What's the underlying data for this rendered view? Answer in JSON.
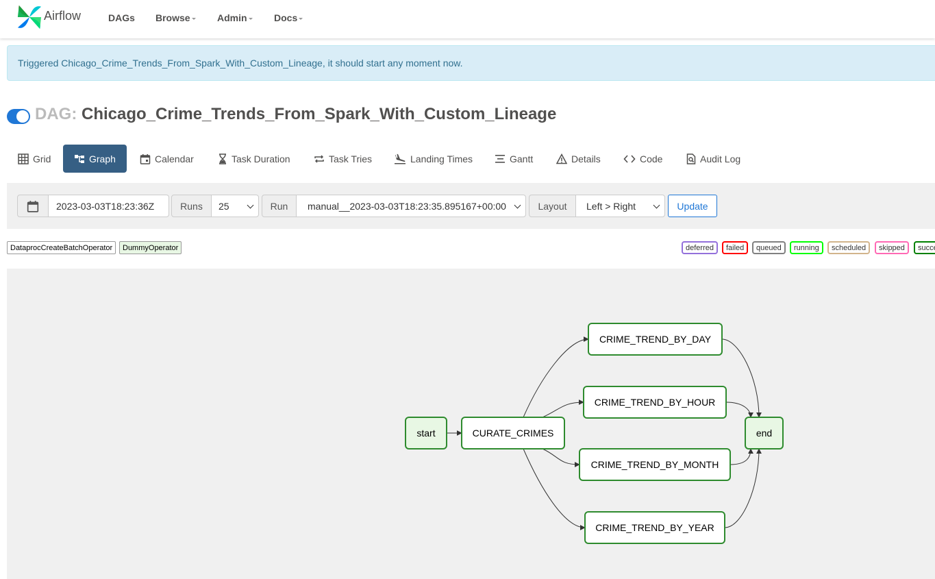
{
  "navbar": {
    "brand": "Airflow",
    "items": [
      "DAGs",
      "Browse",
      "Admin",
      "Docs"
    ]
  },
  "alert": {
    "message": "Triggered Chicago_Crime_Trends_From_Spark_With_Custom_Lineage, it should start any moment now."
  },
  "dag": {
    "prefix": "DAG:",
    "name": "Chicago_Crime_Trends_From_Spark_With_Custom_Lineage",
    "paused": false
  },
  "tabs": [
    {
      "label": "Grid",
      "icon": "grid-icon"
    },
    {
      "label": "Graph",
      "icon": "graph-icon",
      "active": true
    },
    {
      "label": "Calendar",
      "icon": "calendar-icon"
    },
    {
      "label": "Task Duration",
      "icon": "hourglass-icon"
    },
    {
      "label": "Task Tries",
      "icon": "repeat-icon"
    },
    {
      "label": "Landing Times",
      "icon": "plane-landing-icon"
    },
    {
      "label": "Gantt",
      "icon": "gantt-icon"
    },
    {
      "label": "Details",
      "icon": "warning-triangle-icon"
    },
    {
      "label": "Code",
      "icon": "code-icon"
    },
    {
      "label": "Audit Log",
      "icon": "file-search-icon"
    }
  ],
  "toolbar": {
    "date": "2023-03-03T18:23:36Z",
    "runs_label": "Runs",
    "runs_value": "25",
    "run_label": "Run",
    "run_value": "manual__2023-03-03T18:23:35.895167+00:00",
    "layout_label": "Layout",
    "layout_value": "Left > Right",
    "update_label": "Update"
  },
  "operators": [
    {
      "label": "DataprocCreateBatchOperator",
      "color": "#ffffff"
    },
    {
      "label": "DummyOperator",
      "color": "#e8f7e4"
    }
  ],
  "states": [
    {
      "label": "deferred",
      "color": "#9370db"
    },
    {
      "label": "failed",
      "color": "#ff0000"
    },
    {
      "label": "queued",
      "color": "#808080"
    },
    {
      "label": "running",
      "color": "#00ff00"
    },
    {
      "label": "scheduled",
      "color": "#d2b48c"
    },
    {
      "label": "skipped",
      "color": "#ff69b4"
    },
    {
      "label": "success",
      "color": "#008000"
    }
  ],
  "graph": {
    "success_color": "#2e8b2e",
    "nodes": [
      {
        "id": "start",
        "label": "start",
        "operator": "DummyOperator"
      },
      {
        "id": "curate",
        "label": "CURATE_CRIMES",
        "operator": "DataprocCreateBatchOperator"
      },
      {
        "id": "day",
        "label": "CRIME_TREND_BY_DAY",
        "operator": "DataprocCreateBatchOperator"
      },
      {
        "id": "hour",
        "label": "CRIME_TREND_BY_HOUR",
        "operator": "DataprocCreateBatchOperator"
      },
      {
        "id": "month",
        "label": "CRIME_TREND_BY_MONTH",
        "operator": "DataprocCreateBatchOperator"
      },
      {
        "id": "year",
        "label": "CRIME_TREND_BY_YEAR",
        "operator": "DataprocCreateBatchOperator"
      },
      {
        "id": "end",
        "label": "end",
        "operator": "DummyOperator"
      }
    ],
    "edges": [
      [
        "start",
        "curate"
      ],
      [
        "curate",
        "day"
      ],
      [
        "curate",
        "hour"
      ],
      [
        "curate",
        "month"
      ],
      [
        "curate",
        "year"
      ],
      [
        "day",
        "end"
      ],
      [
        "hour",
        "end"
      ],
      [
        "month",
        "end"
      ],
      [
        "year",
        "end"
      ]
    ]
  }
}
